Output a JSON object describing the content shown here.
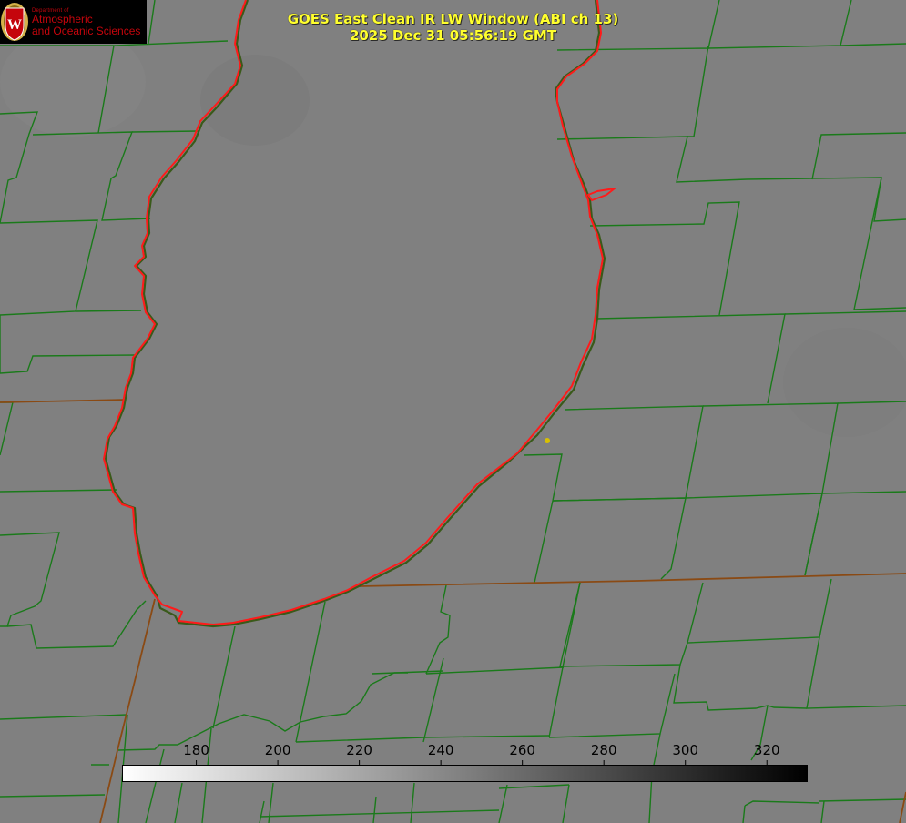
{
  "header": {
    "logo": {
      "department": "Department of",
      "line1": "Atmospheric",
      "line2": "and Oceanic Sciences",
      "badge_letter": "W"
    },
    "title_line1": "GOES East Clean IR LW Window (ABI ch 13)",
    "title_line2": "2025 Dec 31 05:56:19 GMT"
  },
  "colorbar": {
    "ticks": [
      "180",
      "200",
      "220",
      "240",
      "260",
      "280",
      "300",
      "320"
    ],
    "min": 162,
    "max": 330
  },
  "colors": {
    "background": "#808080",
    "county_lines": "#1a7a1a",
    "state_lines": "#8a4a14",
    "lake_outline": "#ff1a1a",
    "title": "#ffff2e",
    "marker": "#d8c000"
  }
}
